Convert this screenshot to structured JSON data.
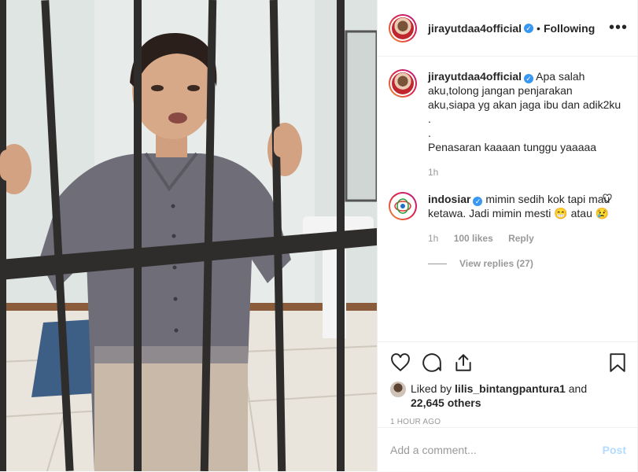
{
  "header": {
    "username": "jirayutdaa4official",
    "separator": "•",
    "follow_status": "Following",
    "more_icon": "more-dots-icon"
  },
  "caption": {
    "username": "jirayutdaa4official",
    "lines": [
      "Apa salah",
      "aku,tolong jangan penjarakan",
      "aku,siapa yg akan jaga ibu dan adik2ku",
      ".",
      ".",
      "Penasaran kaaaan tunggu yaaaaa"
    ],
    "time": "1h"
  },
  "comment": {
    "username": "indosiar",
    "text_part1": "mimin sedih kok tapi mau ketawa. Jadi mimin mesti",
    "emoji1": "😁",
    "text_part2": "atau",
    "emoji2": "😢",
    "time": "1h",
    "likes": "100 likes",
    "reply": "Reply",
    "view_replies": "View replies (27)"
  },
  "actions": {
    "liked_prefix": "Liked by",
    "liked_user": "lilis_bintangpantura1",
    "liked_and": "and",
    "liked_others": "22,645 others",
    "timestamp": "1 HOUR AGO"
  },
  "add_comment": {
    "placeholder": "Add a comment...",
    "post_label": "Post"
  },
  "colors": {
    "verified": "#3897f0",
    "post_button": "#b3dbff",
    "muted": "#999999"
  }
}
